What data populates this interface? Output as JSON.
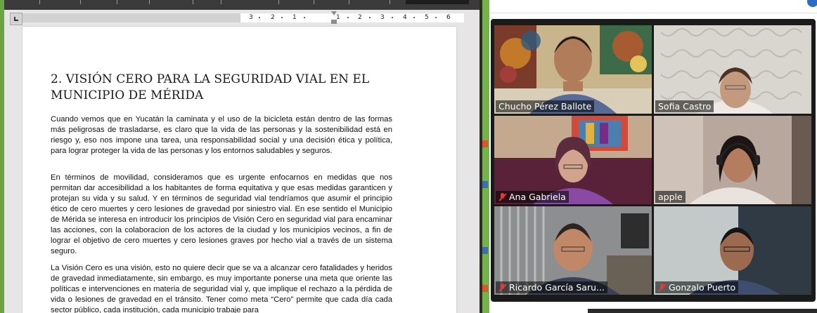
{
  "document": {
    "ruler_numbers": [
      "3",
      "2",
      "1",
      "1",
      "2",
      "3",
      "4",
      "5",
      "6"
    ],
    "heading": "2. VISIÓN CERO PARA LA SEGURIDAD VIAL EN EL MUNICIPIO DE MÉRIDA",
    "paragraphs": [
      "Cuando vemos que en Yucatán la caminata y el uso de la bicicleta están dentro de las formas más peligrosas de trasladarse, es claro que la vida de las personas y la sostenibilidad está en riesgo y, eso nos impone una tarea, una responsabilidad social y una decisión ética y política, para lograr proteger la vida de las personas y los entornos saludables y seguros.",
      "En términos de movilidad, consideramos que es urgente enfocarnos en medidas que nos permitan dar accesibilidad a los habitantes de forma equitativa y que esas medidas garanticen y protejan su vida y su salud. Y en términos de seguridad vial tendríamos que asumir el principio ético de cero muertes y cero lesiones de gravedad por siniestro vial. En ese sentido el Municipio de Mérida se interesa en introducir los principios de Visión Cero en seguridad vial para encaminar las acciones, con la colaboracion de los actores de la ciudad y los municipios vecinos, a fin de lograr el objetivo de cero muertes y cero lesiones graves por hecho vial a través de un sistema seguro.",
      "La Visión Cero es una visión,  esto no quiere decir que se va a alcanzar cero fatalidades y heridos de gravedad inmediatamente, sin embargo,  es muy importante ponerse una meta que oriente las políticas e intervenciones en materia de seguridad vial y, que implique el rechazo a la pérdida de vida o lesiones de gravedad en el tránsito. Tener como meta “Cero” permite que cada día cada sector público, cada institución, cada municipio trabaje para"
    ]
  },
  "meeting": {
    "participants": [
      {
        "name": "Chucho Pérez Ballote",
        "muted": false,
        "active": false,
        "bg": "#b9a37a",
        "skin": "#b07c5a",
        "hair": "#1a1410",
        "shirt": "#6d7aa6"
      },
      {
        "name": "Sofia Castro",
        "muted": false,
        "active": false,
        "bg": "#d7d3cb",
        "skin": "#c49a7e",
        "hair": "#4a3326",
        "shirt": "#efe9e4"
      },
      {
        "name": "Ana Gabriela",
        "muted": true,
        "active": false,
        "bg": "#7c2f4a",
        "skin": "#d3a48d",
        "hair": "#5b2b3e",
        "shirt": "#8a4aa3"
      },
      {
        "name": "apple",
        "muted": false,
        "active": true,
        "bg": "#b5a49a",
        "skin": "#b57d60",
        "hair": "#1c1514",
        "shirt": "#e9e2dd"
      },
      {
        "name": "Ricardo García Saru...",
        "muted": true,
        "active": false,
        "bg": "#8c8e8f",
        "skin": "#c08867",
        "hair": "#2b2420",
        "shirt": "#3c4156"
      },
      {
        "name": "Gonzalo Puerto",
        "muted": true,
        "active": false,
        "bg": "#8e9a9e",
        "skin": "#9b6a4f",
        "hair": "#141414",
        "shirt": "#3f4d6e"
      }
    ]
  }
}
